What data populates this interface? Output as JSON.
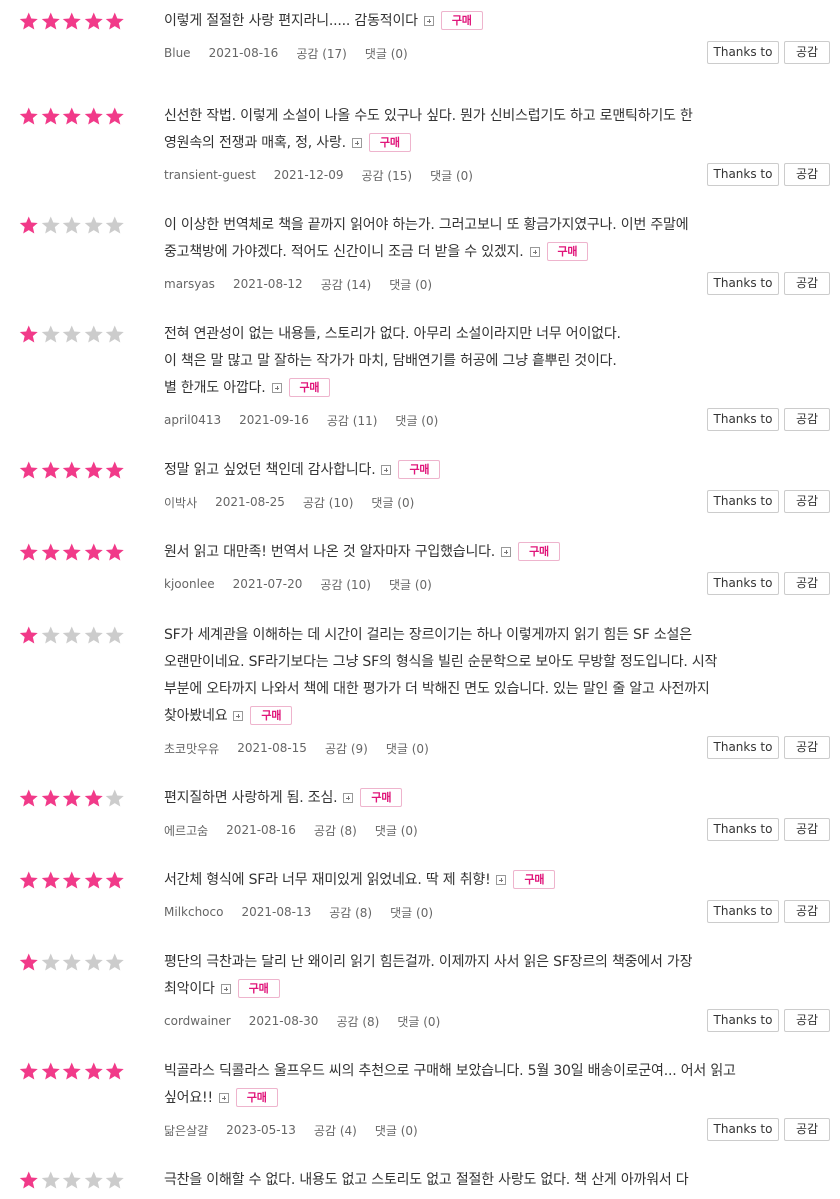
{
  "buttons": {
    "thanks_label": "Thanks to",
    "like_label": "공감"
  },
  "buy_label": "구매",
  "colors": {
    "star_on": "#f13a89",
    "star_off": "#cccccc",
    "buy_text": "#e0157a"
  },
  "reviews": [
    {
      "rating": 5,
      "lines": [
        "이렇게 절절한 사랑 편지라니..... 감동적이다"
      ],
      "author": "Blue",
      "date": "2021-08-16",
      "likes": "공감 (17)",
      "comments": "댓글 (0)"
    },
    {
      "rating": 5,
      "lines": [
        "신선한 작법. 이렇게 소설이 나올 수도 있구나 싶다. 뭔가 신비스럽기도 하고 로맨틱하기도 한",
        "영원속의 전쟁과 매혹, 정, 사랑."
      ],
      "author": "transient-guest",
      "date": "2021-12-09",
      "likes": "공감 (15)",
      "comments": "댓글 (0)"
    },
    {
      "rating": 1,
      "lines": [
        "이 이상한 번역체로 책을 끝까지 읽어야 하는가. 그러고보니 또 황금가지였구나. 이번 주말에",
        "중고책방에 가야겠다. 적어도 신간이니 조금 더 받을 수 있겠지."
      ],
      "author": "marsyas",
      "date": "2021-08-12",
      "likes": "공감 (14)",
      "comments": "댓글 (0)"
    },
    {
      "rating": 1,
      "lines": [
        "전혀 연관성이 없는 내용들, 스토리가 없다. 아무리 소설이라지만 너무 어이없다.",
        "이 책은 말 많고 말 잘하는 작가가 마치, 담배연기를 허공에 그냥 흩뿌린 것이다.",
        "별 한개도 아깝다."
      ],
      "author": "april0413",
      "date": "2021-09-16",
      "likes": "공감 (11)",
      "comments": "댓글 (0)"
    },
    {
      "rating": 5,
      "lines": [
        "정말 읽고 싶었던 책인데 감사합니다."
      ],
      "author": "이박사",
      "date": "2021-08-25",
      "likes": "공감 (10)",
      "comments": "댓글 (0)"
    },
    {
      "rating": 5,
      "lines": [
        "원서 읽고 대만족! 번역서 나온 것 알자마자 구입했습니다."
      ],
      "author": "kjoonlee",
      "date": "2021-07-20",
      "likes": "공감 (10)",
      "comments": "댓글 (0)"
    },
    {
      "rating": 1,
      "lines": [
        "SF가 세계관을 이해하는 데 시간이 걸리는 장르이기는 하나 이렇게까지 읽기 힘든 SF 소설은",
        "오랜만이네요. SF라기보다는 그냥 SF의 형식을 빌린 순문학으로 보아도 무방할 정도입니다. 시작",
        "부분에 오타까지 나와서 책에 대한 평가가 더 박해진 면도 있습니다. 있는 말인 줄 알고 사전까지",
        "찾아봤네요"
      ],
      "author": "초코맛우유",
      "date": "2021-08-15",
      "likes": "공감 (9)",
      "comments": "댓글 (0)"
    },
    {
      "rating": 4,
      "lines": [
        "편지질하면 사랑하게 됨. 조심."
      ],
      "author": "에르고숨",
      "date": "2021-08-16",
      "likes": "공감 (8)",
      "comments": "댓글 (0)"
    },
    {
      "rating": 5,
      "lines": [
        "서간체 형식에 SF라 너무 재미있게 읽었네요. 딱 제 취향!"
      ],
      "author": "Milkchoco",
      "date": "2021-08-13",
      "likes": "공감 (8)",
      "comments": "댓글 (0)"
    },
    {
      "rating": 1,
      "lines": [
        "평단의 극찬과는 달리 난 왜이리 읽기 힘든걸까. 이제까지 사서 읽은 SF장르의 책중에서 가장",
        "최악이다"
      ],
      "author": "cordwainer",
      "date": "2021-08-30",
      "likes": "공감 (8)",
      "comments": "댓글 (0)"
    },
    {
      "rating": 5,
      "lines": [
        "빅골라스 딕콜라스 울프우드 씨의 추천으로 구매해 보았습니다. 5월 30일 배송이로군여... 어서 읽고",
        "싶어요!!"
      ],
      "author": "닮은살걀",
      "date": "2023-05-13",
      "likes": "공감 (4)",
      "comments": "댓글 (0)"
    },
    {
      "rating": 1,
      "lines": [
        "극찬을 이해할 수 없다. 내용도 없고 스토리도 없고 절절한 사랑도 없다. 책 산게 아까워서 다"
      ],
      "author": "",
      "date": "",
      "likes": "",
      "comments": "",
      "partial": true
    }
  ]
}
